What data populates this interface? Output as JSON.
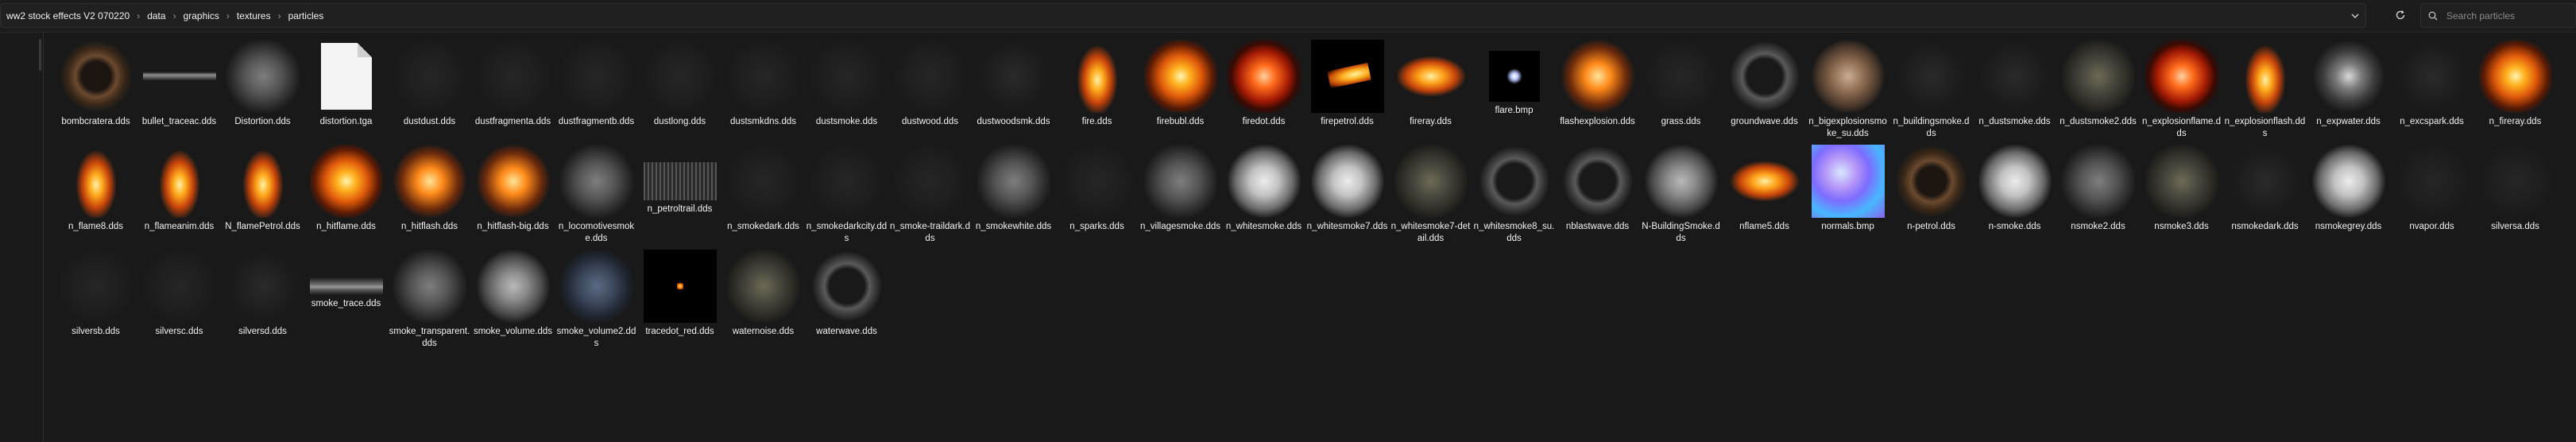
{
  "address_bar": {
    "breadcrumbs": [
      "ww2 stock effects V2 070220",
      "data",
      "graphics",
      "textures",
      "particles"
    ],
    "separator": "›",
    "dropdown_icon": "chevron-down-icon",
    "refresh_icon": "refresh-icon"
  },
  "search": {
    "placeholder": "Search particles",
    "icon": "search-icon"
  },
  "files": [
    {
      "name": "bombcratera.dds",
      "thumb": "t-ring-brown"
    },
    {
      "name": "bullet_traceac.dds",
      "thumb": "t-bullet"
    },
    {
      "name": "Distortion.dds",
      "thumb": "t-smoke-mid"
    },
    {
      "name": "distortion.tga",
      "thumb": "file"
    },
    {
      "name": "dustdust.dds",
      "thumb": "t-faint"
    },
    {
      "name": "dustfragmenta.dds",
      "thumb": "t-faint"
    },
    {
      "name": "dustfragmentb.dds",
      "thumb": "t-faint"
    },
    {
      "name": "dustlong.dds",
      "thumb": "t-faint"
    },
    {
      "name": "dustsmkdns.dds",
      "thumb": "t-faint"
    },
    {
      "name": "dustsmoke.dds",
      "thumb": "t-faint"
    },
    {
      "name": "dustwood.dds",
      "thumb": "t-faint"
    },
    {
      "name": "dustwoodsmk.dds",
      "thumb": "t-dark"
    },
    {
      "name": "fire.dds",
      "thumb": "t-fire-tall"
    },
    {
      "name": "firebubl.dds",
      "thumb": "t-fire"
    },
    {
      "name": "firedot.dds",
      "thumb": "t-fire-red"
    },
    {
      "name": "firepetrol.dds",
      "thumb": "t-black-fire"
    },
    {
      "name": "fireray.dds",
      "thumb": "t-fire-flat"
    },
    {
      "name": "flare.bmp",
      "thumb": "t-flare"
    },
    {
      "name": "flashexplosion.dds",
      "thumb": "t-flash"
    },
    {
      "name": "grass.dds",
      "thumb": "t-faint"
    },
    {
      "name": "groundwave.dds",
      "thumb": "t-ring"
    },
    {
      "name": "n_bigexplosionsmoke_su.dds",
      "thumb": "t-smoke-brown"
    },
    {
      "name": "n_buildingsmoke.dds",
      "thumb": "t-dark"
    },
    {
      "name": "n_dustsmoke.dds",
      "thumb": "t-dark"
    },
    {
      "name": "n_dustsmoke2.dds",
      "thumb": "t-smoke-olive"
    },
    {
      "name": "n_explosionflame.dds",
      "thumb": "t-fire-red"
    },
    {
      "name": "n_explosionflash.dds",
      "thumb": "t-fire-tall"
    },
    {
      "name": "n_expwater.dds",
      "thumb": "t-sparkle"
    },
    {
      "name": "n_excspark.dds",
      "thumb": "t-dark"
    },
    {
      "name": "n_fireray.dds",
      "thumb": "t-fire"
    },
    {
      "name": "n_flame8.dds",
      "thumb": "t-fire-tall"
    },
    {
      "name": "n_flameanim.dds",
      "thumb": "t-fire-tall"
    },
    {
      "name": "N_flamePetrol.dds",
      "thumb": "t-fire-tall"
    },
    {
      "name": "n_hitflame.dds",
      "thumb": "t-fire"
    },
    {
      "name": "n_hitflash.dds",
      "thumb": "t-flash"
    },
    {
      "name": "n_hitflash-big.dds",
      "thumb": "t-flash"
    },
    {
      "name": "n_locomotivesmoke.dds",
      "thumb": "t-smoke-mid"
    },
    {
      "name": "n_petroltrail.dds",
      "thumb": "t-streaks"
    },
    {
      "name": "n_smokedark.dds",
      "thumb": "t-faint"
    },
    {
      "name": "n_smokedarkcity.dds",
      "thumb": "t-faint"
    },
    {
      "name": "n_smoke-traildark.dds",
      "thumb": "t-faint"
    },
    {
      "name": "n_smokewhite.dds",
      "thumb": "t-smoke-mid"
    },
    {
      "name": "n_sparks.dds",
      "thumb": "t-faint"
    },
    {
      "name": "n_villagesmoke.dds",
      "thumb": "t-smoke-mid"
    },
    {
      "name": "n_whitesmoke.dds",
      "thumb": "t-smoke-light"
    },
    {
      "name": "n_whitesmoke7.dds",
      "thumb": "t-smoke-light"
    },
    {
      "name": "n_whitesmoke7-detail.dds",
      "thumb": "t-smoke-olive"
    },
    {
      "name": "n_whitesmoke8_su.dds",
      "thumb": "t-ring"
    },
    {
      "name": "nblastwave.dds",
      "thumb": "t-ring"
    },
    {
      "name": "N-BuildingSmoke.dds",
      "thumb": "t-smoke-grey"
    },
    {
      "name": "nflame5.dds",
      "thumb": "t-fire-flat"
    },
    {
      "name": "normals.bmp",
      "thumb": "t-normals"
    },
    {
      "name": "n-petrol.dds",
      "thumb": "t-ring-brown"
    },
    {
      "name": "n-smoke.dds",
      "thumb": "t-smoke-light"
    },
    {
      "name": "nsmoke2.dds",
      "thumb": "t-smoke-mid"
    },
    {
      "name": "nsmoke3.dds",
      "thumb": "t-smoke-olive"
    },
    {
      "name": "nsmokedark.dds",
      "thumb": "t-dark"
    },
    {
      "name": "nsmokegrey.dds",
      "thumb": "t-smoke-light"
    },
    {
      "name": "nvapor.dds",
      "thumb": "t-faint"
    },
    {
      "name": "silversa.dds",
      "thumb": "t-faint"
    },
    {
      "name": "silversb.dds",
      "thumb": "t-faint"
    },
    {
      "name": "silversc.dds",
      "thumb": "t-faint"
    },
    {
      "name": "silversd.dds",
      "thumb": "t-dark"
    },
    {
      "name": "smoke_trace.dds",
      "thumb": "t-smoketrace"
    },
    {
      "name": "smoke_transparent.dds",
      "thumb": "t-smoke-mid"
    },
    {
      "name": "smoke_volume.dds",
      "thumb": "t-smoke-grey"
    },
    {
      "name": "smoke_volume2.dds",
      "thumb": "t-blue"
    },
    {
      "name": "tracedot_red.dds",
      "thumb": "t-tracer"
    },
    {
      "name": "waternoise.dds",
      "thumb": "t-smoke-olive"
    },
    {
      "name": "waterwave.dds",
      "thumb": "t-ring"
    }
  ]
}
